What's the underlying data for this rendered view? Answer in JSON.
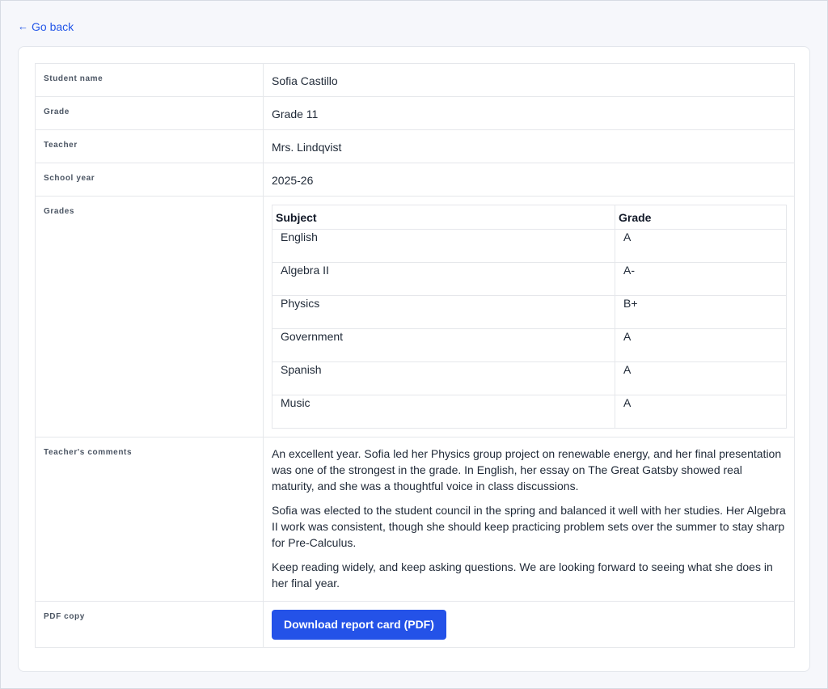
{
  "nav": {
    "back_label": "Go back"
  },
  "student": {
    "fields": [
      {
        "label": "Student name",
        "value": "Sofia Castillo"
      },
      {
        "label": "Grade",
        "value": "Grade 11"
      },
      {
        "label": "Teacher",
        "value": "Mrs. Lindqvist"
      },
      {
        "label": "School year",
        "value": "2025-26"
      }
    ],
    "grades_label": "Grades",
    "grades_table": {
      "headers": [
        "Subject",
        "Grade"
      ],
      "rows": [
        [
          "English",
          "A"
        ],
        [
          "Algebra II",
          "A-"
        ],
        [
          "Physics",
          "B+"
        ],
        [
          "Government",
          "A"
        ],
        [
          "Spanish",
          "A"
        ],
        [
          "Music",
          "A"
        ]
      ]
    },
    "comments_label": "Teacher's comments",
    "comments": [
      "An excellent year. Sofia led her Physics group project on renewable energy, and her final presentation was one of the strongest in the grade. In English, her essay on The Great Gatsby showed real maturity, and she was a thoughtful voice in class discussions.",
      "Sofia was elected to the student council in the spring and balanced it well with her studies. Her Algebra II work was consistent, though she should keep practicing problem sets over the summer to stay sharp for Pre-Calculus.",
      "Keep reading widely, and keep asking questions. We are looking forward to seeing what she does in her final year."
    ],
    "pdf_label": "PDF copy",
    "pdf_button_label": "Download report card (PDF)"
  },
  "colors": {
    "accent": "#2452e8",
    "link": "#2457e8",
    "background": "#f6f7fb",
    "border": "#e5e7eb"
  }
}
